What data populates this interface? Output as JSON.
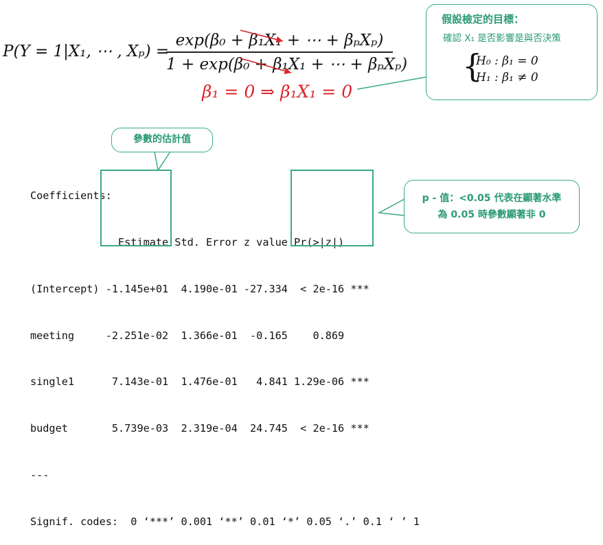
{
  "formula": {
    "lhs_text": "P(Y = 1|X₁, ⋯ , Xₚ) =",
    "numerator": "exp(β₀ + β₁X₁ + ⋯ + βₚXₚ)",
    "denominator": "1 + exp(β₀ + β₁X₁ + ⋯ + βₚXₚ)",
    "implication": "β₁ = 0  ⇒  β₁X₁ = 0"
  },
  "hypothesis_callout": {
    "title": "假設檢定的目標：",
    "subtitle": "確認 X₁ 是否影響是與否決策",
    "h0": "H₀ :  β₁ = 0",
    "h1": "H₁ :  β₁ ≠ 0"
  },
  "param_callout": {
    "label": "參數的估計值"
  },
  "pvalue_callout": {
    "line1": "p - 值：<0.05 代表在顯著水準",
    "line2": "為 0.05 時參數顯著非 0"
  },
  "r_output": {
    "lines": [
      "Coefficients:",
      "              Estimate Std. Error z value Pr(>|z|)    ",
      "(Intercept) -1.145e+01  4.190e-01 -27.334  < 2e-16 ***",
      "meeting     -2.251e-02  1.366e-01  -0.165    0.869    ",
      "single1      7.143e-01  1.476e-01   4.841 1.29e-06 ***",
      "budget       5.739e-03  2.319e-04  24.745  < 2e-16 ***",
      "---",
      "Signif. codes:  0 ‘***’ 0.001 ‘**’ 0.01 ‘*’ 0.05 ‘.’ 0.1 ‘ ’ 1"
    ]
  },
  "colors": {
    "accent": "#3aa987",
    "accent_text": "#2a9a77",
    "red": "#d9262c"
  }
}
